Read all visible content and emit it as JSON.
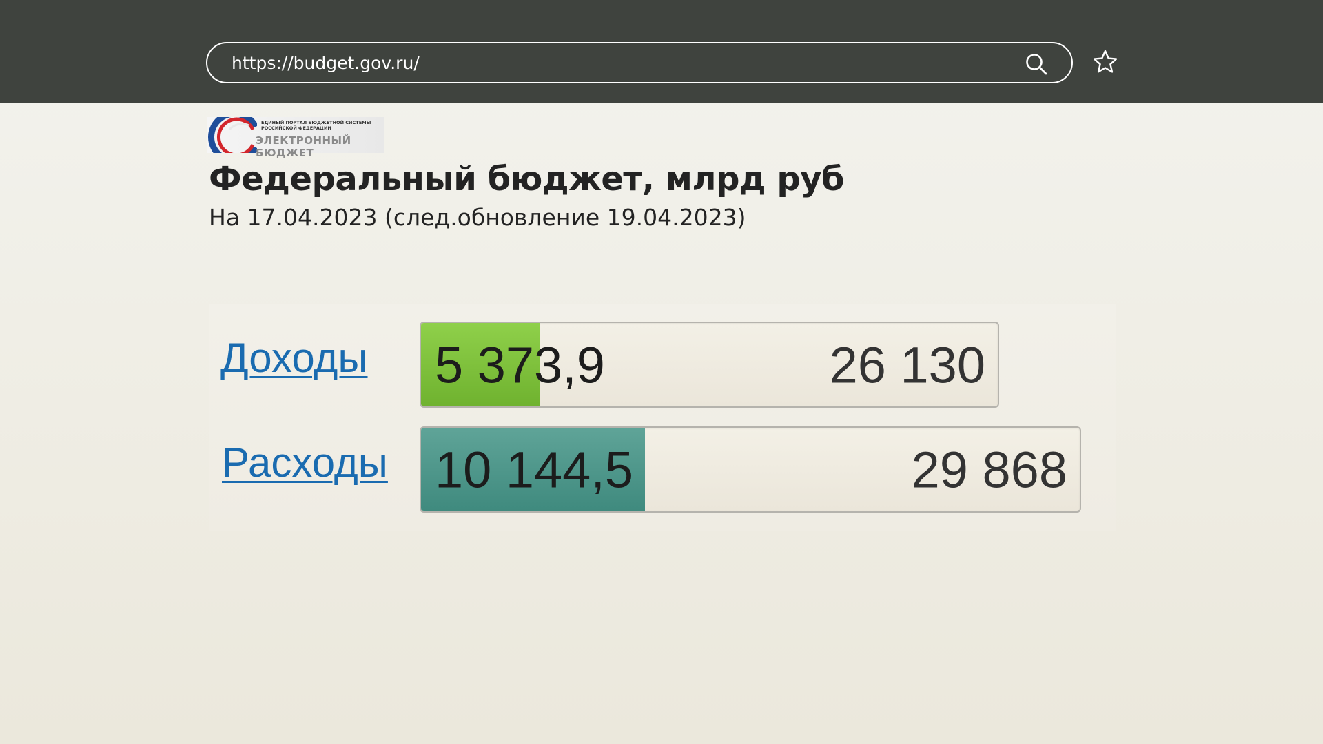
{
  "browser": {
    "url": "https://budget.gov.ru/",
    "search_icon": "search-icon",
    "bookmark_icon": "star-icon"
  },
  "logo": {
    "small_text": "ЕДИНЫЙ ПОРТАЛ БЮДЖЕТНОЙ СИСТЕМЫ РОССИЙСКОЙ ФЕДЕРАЦИИ",
    "big_text": "ЭЛЕКТРОННЫЙ БЮДЖЕТ"
  },
  "header": {
    "title": "Федеральный бюджет, млрд руб",
    "subtitle": "На 17.04.2023 (след.обновление 19.04.2023)"
  },
  "budget": {
    "rows": [
      {
        "label": "Доходы",
        "value": "5 373,9",
        "total": "26 130",
        "fill_fraction": 0.2057,
        "color": "#7cc13a"
      },
      {
        "label": "Расходы",
        "value": "10 144,5",
        "total": "29 868",
        "fill_fraction": 0.3397,
        "color": "#4a968a"
      }
    ]
  },
  "colors": {
    "topbar": "#3f433e",
    "link": "#1a6bb0"
  }
}
